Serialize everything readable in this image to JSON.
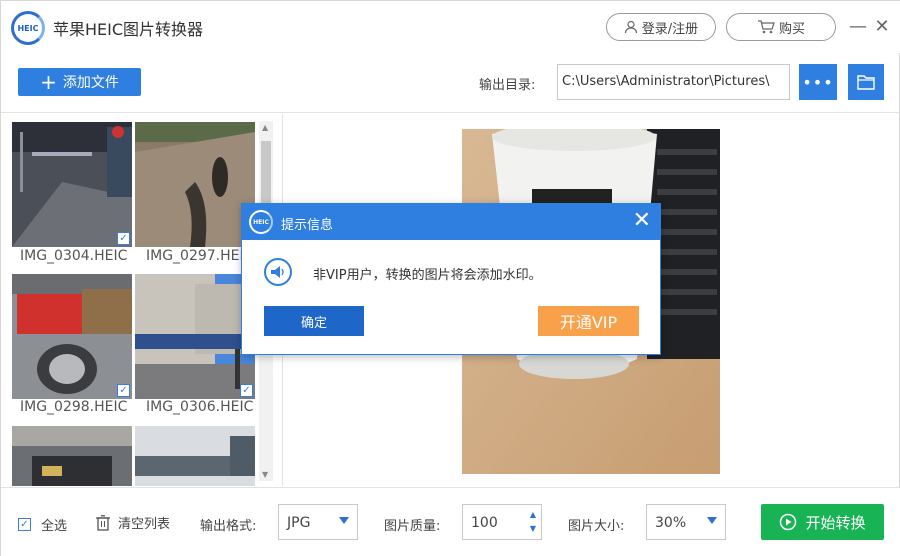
{
  "app": {
    "title": "苹果HEIC图片转换器",
    "logo_text": "HEIC",
    "login_label": "登录/注册",
    "buy_label": "购买",
    "minimize_glyph": "—",
    "close_glyph": "✕"
  },
  "toolbar": {
    "add_file_label": "添加文件",
    "output_dir_label": "输出目录:",
    "output_path": "C:\\Users\\Administrator\\Pictures\\",
    "more_glyph": "•••"
  },
  "thumbnails": [
    {
      "name": "IMG_0304.HEIC",
      "checked": true
    },
    {
      "name": "IMG_0297.HEIC",
      "checked": false
    },
    {
      "name": "IMG_0298.HEIC",
      "checked": true
    },
    {
      "name": "IMG_0306.HEIC",
      "checked": true
    },
    {
      "name": "",
      "checked": false
    },
    {
      "name": "",
      "checked": false
    }
  ],
  "bottom": {
    "select_all_label": "全选",
    "clear_list_label": "清空列表",
    "output_format_label": "输出格式:",
    "output_format_value": "JPG",
    "quality_label": "图片质量:",
    "quality_value": "100",
    "size_label": "图片大小:",
    "size_value": "30%",
    "start_label": "开始转换"
  },
  "dialog": {
    "title": "提示信息",
    "message": "非VIP用户，转换的图片将会添加水印。",
    "ok_label": "确定",
    "vip_label": "开通VIP"
  },
  "colors": {
    "accent_blue": "#2f7fe0",
    "start_green": "#17b354",
    "vip_orange": "#f9a04a"
  },
  "icons": [
    "heic-logo-icon",
    "user-icon",
    "cart-icon",
    "minimize-icon",
    "close-icon",
    "plus-icon",
    "more-icon",
    "folder-icon",
    "trash-icon",
    "play-icon",
    "speaker-icon"
  ]
}
